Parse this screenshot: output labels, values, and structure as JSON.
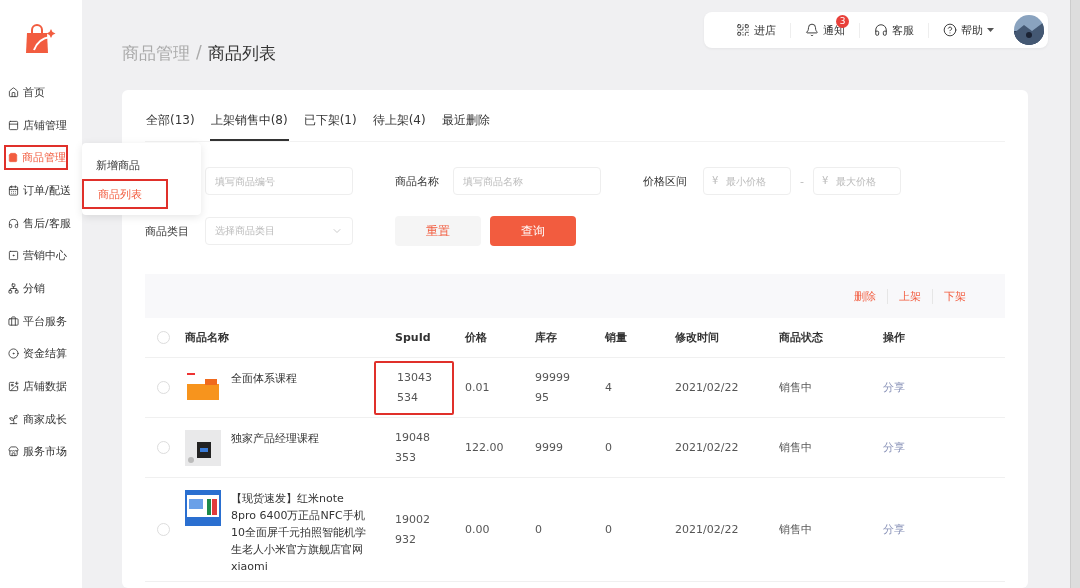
{
  "sidebar": {
    "items": [
      {
        "label": "首页",
        "selected": false,
        "highlighted": false
      },
      {
        "label": "店铺管理",
        "selected": false,
        "highlighted": false
      },
      {
        "label": "商品管理",
        "selected": true,
        "highlighted": true
      },
      {
        "label": "订单/配送",
        "selected": false,
        "highlighted": false
      },
      {
        "label": "售后/客服",
        "selected": false,
        "highlighted": false
      },
      {
        "label": "营销中心",
        "selected": false,
        "highlighted": false
      },
      {
        "label": "分销",
        "selected": false,
        "highlighted": false
      },
      {
        "label": "平台服务",
        "selected": false,
        "highlighted": false
      },
      {
        "label": "资金结算",
        "selected": false,
        "highlighted": false
      },
      {
        "label": "店铺数据",
        "selected": false,
        "highlighted": false
      },
      {
        "label": "商家成长",
        "selected": false,
        "highlighted": false
      },
      {
        "label": "服务市场",
        "selected": false,
        "highlighted": false
      }
    ]
  },
  "submenu": {
    "items": [
      {
        "label": "新增商品",
        "selected": false,
        "highlighted": false
      },
      {
        "label": "商品列表",
        "selected": true,
        "highlighted": true
      }
    ]
  },
  "header": {
    "items": [
      {
        "label": "进店"
      },
      {
        "label": "通知",
        "badge": "3"
      },
      {
        "label": "客服"
      },
      {
        "label": "帮助"
      }
    ]
  },
  "breadcrumb": {
    "parent": "商品管理",
    "separator": "/",
    "current": "商品列表"
  },
  "tabs": [
    {
      "label": "全部(13)",
      "selected": false
    },
    {
      "label": "上架销售中(8)",
      "selected": true
    },
    {
      "label": "已下架(1)",
      "selected": false
    },
    {
      "label": "待上架(4)",
      "selected": false
    },
    {
      "label": "最近删除",
      "selected": false
    }
  ],
  "filters": {
    "code_placeholder": "填写商品编号",
    "name_label": "商品名称",
    "name_placeholder": "填写商品名称",
    "price_label": "价格区间",
    "price_min_placeholder": "最小价格",
    "price_max_placeholder": "最大价格",
    "currency": "¥",
    "range_separator": "-",
    "category_label": "商品类目",
    "category_placeholder": "选择商品类目",
    "reset": "重置",
    "query": "查询"
  },
  "bulk_actions": [
    "删除",
    "上架",
    "下架"
  ],
  "table": {
    "select_all": {
      "checked": false
    },
    "columns": [
      "商品名称",
      "SpuId",
      "价格",
      "库存",
      "销量",
      "修改时间",
      "商品状态",
      "操作"
    ],
    "rows": [
      {
        "selected": false,
        "name": "全面体系课程",
        "spuid": "13043\n534",
        "spuid_highlighted": true,
        "price": "0.01",
        "stock": "99999\n95",
        "sales": "4",
        "modified": "2021/02/22",
        "status": "销售中",
        "action": "分享"
      },
      {
        "selected": false,
        "name": "独家产品经理课程",
        "spuid": "19048\n353",
        "spuid_highlighted": false,
        "price": "122.00",
        "stock": "9999",
        "sales": "0",
        "modified": "2021/02/22",
        "status": "销售中",
        "action": "分享"
      },
      {
        "selected": false,
        "name": "【现货速发】红米note 8pro 6400万正品NFC手机10全面屏千元拍照智能机学生老人小米官方旗舰店官网xiaomi",
        "spuid": "19002\n932",
        "spuid_highlighted": false,
        "price": "0.00",
        "stock": "0",
        "sales": "0",
        "modified": "2021/02/22",
        "status": "销售中",
        "action": "分享"
      }
    ]
  }
}
